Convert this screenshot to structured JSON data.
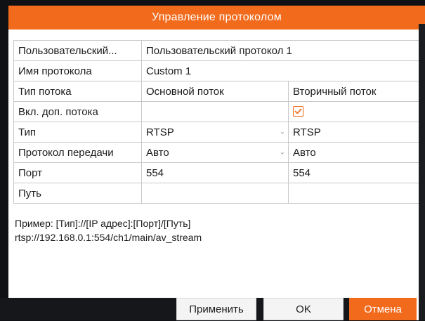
{
  "dialog": {
    "title": "Управление протоколом"
  },
  "grid": {
    "row_custom_protocol": {
      "label": "Пользовательский...",
      "value": "Пользовательский протокол 1"
    },
    "row_protocol_name": {
      "label": "Имя протокола",
      "value": "Custom 1"
    },
    "row_stream_type": {
      "label": "Тип потока",
      "main": "Основной поток",
      "sub": "Вторичный поток"
    },
    "row_enable_substream": {
      "label": "Вкл. доп. потока",
      "sub_checked": true
    },
    "row_type": {
      "label": "Тип",
      "main": "RTSP",
      "sub": "RTSP"
    },
    "row_transport": {
      "label": "Протокол передачи",
      "main": "Авто",
      "sub": "Авто"
    },
    "row_port": {
      "label": "Порт",
      "main": "554",
      "sub": "554"
    },
    "row_path": {
      "label": "Путь",
      "main": "",
      "sub": ""
    }
  },
  "example": {
    "line1": "Пример: [Тип]://[IP адрес]:[Порт]/[Путь]",
    "line2": "rtsp://192.168.0.1:554/ch1/main/av_stream"
  },
  "buttons": {
    "apply": "Применить",
    "ok": "OK",
    "cancel": "Отмена"
  },
  "icons": {
    "dropdown": "chevron-down-icon",
    "check": "checkmark-icon"
  },
  "colors": {
    "accent": "#f26a1b",
    "border": "#c9c9c9",
    "background": "#ffffff"
  }
}
